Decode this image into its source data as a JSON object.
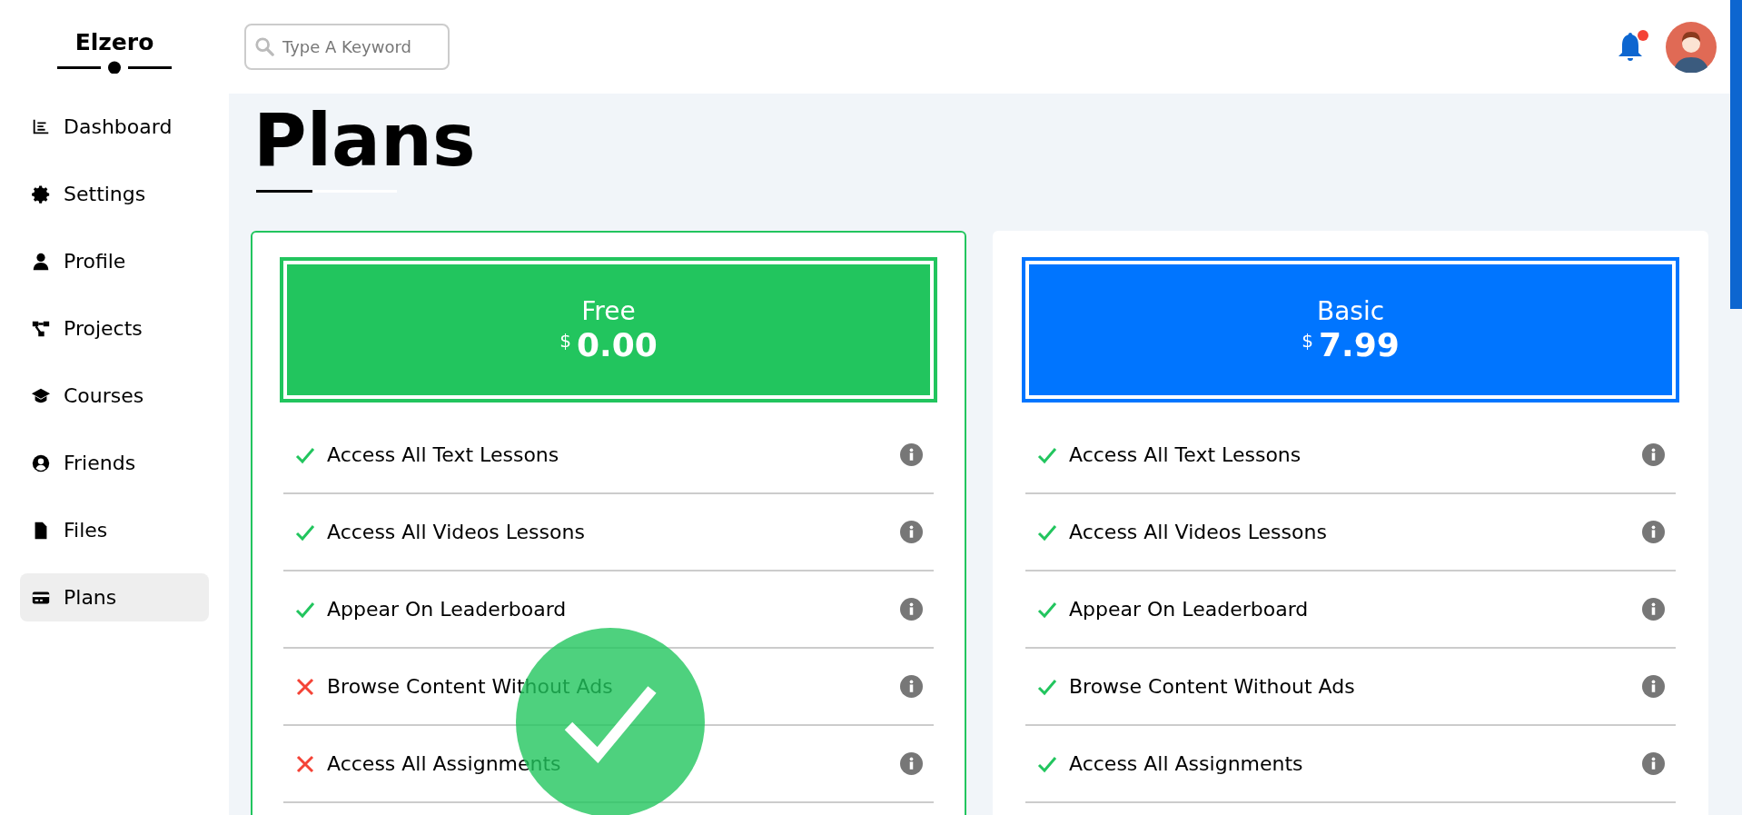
{
  "sidebar": {
    "logo": "Elzero",
    "items": [
      {
        "label": "Dashboard",
        "selected": false
      },
      {
        "label": "Settings",
        "selected": false
      },
      {
        "label": "Profile",
        "selected": false
      },
      {
        "label": "Projects",
        "selected": false
      },
      {
        "label": "Courses",
        "selected": false
      },
      {
        "label": "Friends",
        "selected": false
      },
      {
        "label": "Files",
        "selected": false
      },
      {
        "label": "Plans",
        "selected": true
      }
    ]
  },
  "header": {
    "search": {
      "placeholder": "Type A Keyword"
    },
    "notification_unread": true
  },
  "page_title": "Plans",
  "plans": [
    {
      "name": "Free",
      "currency": "$",
      "price": "0.00",
      "color": "#22c55e",
      "selected": true,
      "features": [
        {
          "label": "Access All Text Lessons",
          "included": true
        },
        {
          "label": "Access All Videos Lessons",
          "included": true
        },
        {
          "label": "Appear On Leaderboard",
          "included": true
        },
        {
          "label": "Browse Content Without Ads",
          "included": false
        },
        {
          "label": "Access All Assignments",
          "included": false
        }
      ]
    },
    {
      "name": "Basic",
      "currency": "$",
      "price": "7.99",
      "color": "#0075ff",
      "selected": false,
      "features": [
        {
          "label": "Access All Text Lessons",
          "included": true
        },
        {
          "label": "Access All Videos Lessons",
          "included": true
        },
        {
          "label": "Appear On Leaderboard",
          "included": true
        },
        {
          "label": "Browse Content Without Ads",
          "included": true
        },
        {
          "label": "Access All Assignments",
          "included": true
        }
      ]
    }
  ]
}
